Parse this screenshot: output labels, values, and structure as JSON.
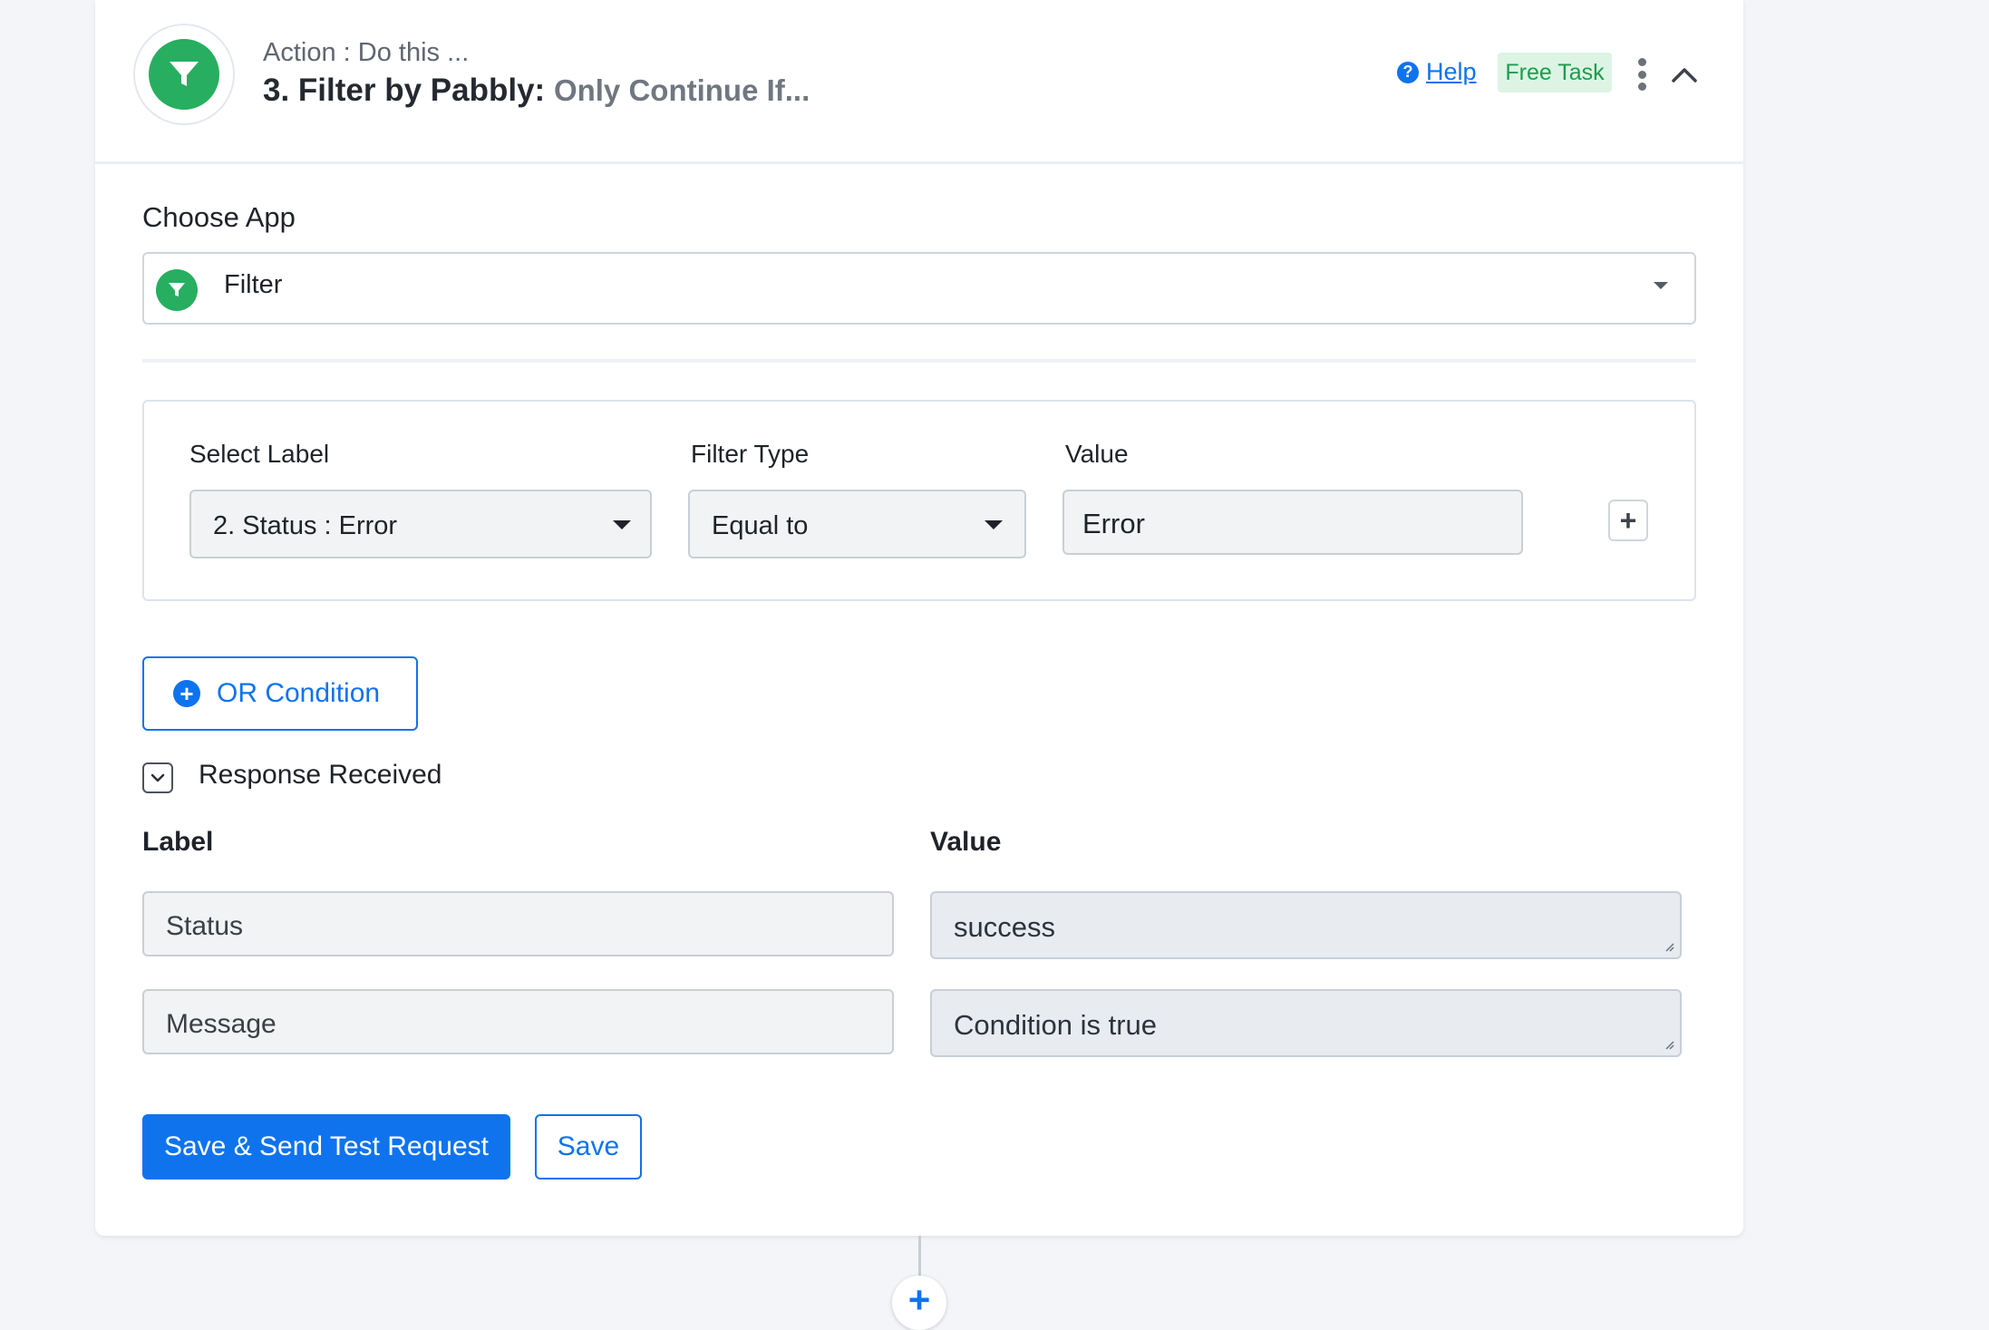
{
  "header": {
    "subtitle": "Action : Do this ...",
    "step_title": "3. Filter by Pabbly:",
    "step_description": "Only Continue If...",
    "help_label": "Help",
    "badge": "Free Task",
    "app_icon": "funnel-icon",
    "accent_color": "#27ae60"
  },
  "choose_app": {
    "label": "Choose App",
    "selected": "Filter",
    "icon": "funnel-icon"
  },
  "condition": {
    "select_label_header": "Select Label",
    "filter_type_header": "Filter Type",
    "value_header": "Value",
    "selected_label": "2. Status : Error",
    "filter_type": "Equal to",
    "value": "Error"
  },
  "or_condition_label": "OR Condition",
  "response": {
    "title": "Response Received",
    "label_header": "Label",
    "value_header": "Value",
    "rows": [
      {
        "label": "Status",
        "value": "success"
      },
      {
        "label": "Message",
        "value": "Condition is true"
      }
    ]
  },
  "actions": {
    "save_send_label": "Save & Send Test Request",
    "save_label": "Save"
  },
  "colors": {
    "primary": "#0f73ee",
    "badge_bg": "#ddf4e4",
    "badge_text": "#1e9c4d"
  }
}
